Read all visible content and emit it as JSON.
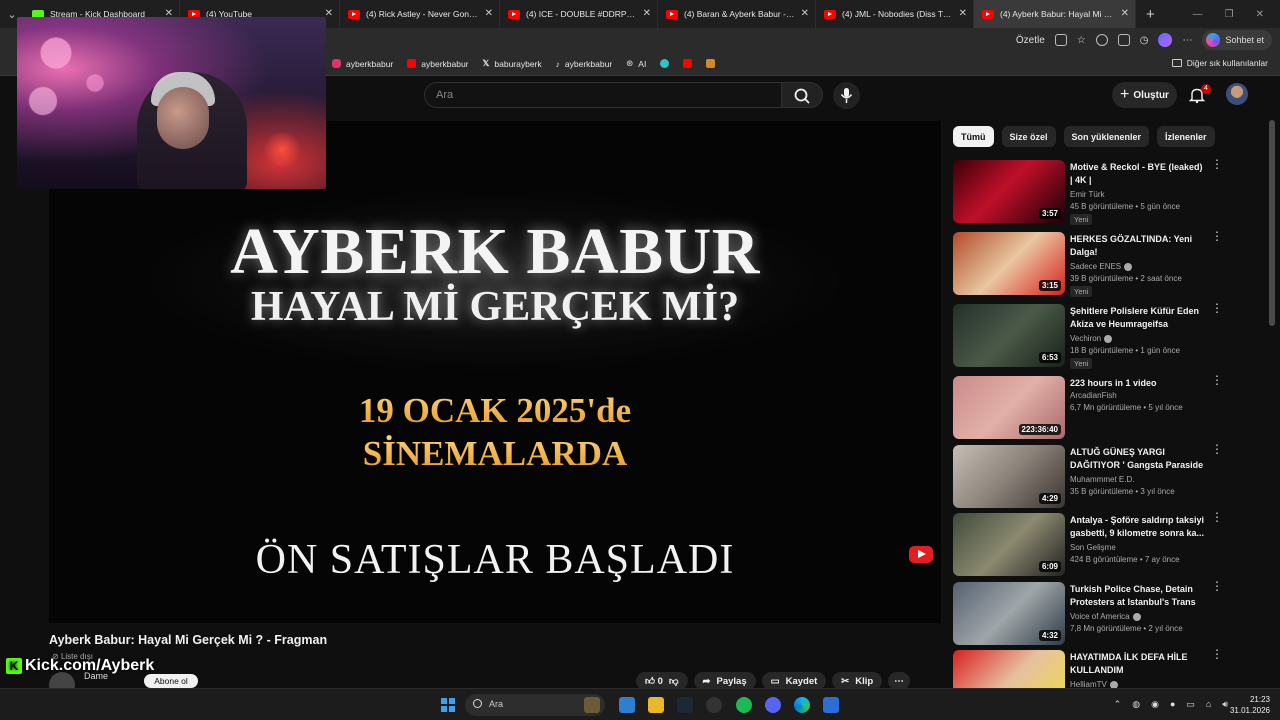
{
  "browser": {
    "tabs": [
      {
        "label": "Stream - Kick Dashboard",
        "icon": "kick-icon",
        "active": false
      },
      {
        "label": "(4) YouTube",
        "icon": "youtube-icon",
        "active": false
      },
      {
        "label": "(4) Rick Astley - Never Gonna Give You Up",
        "icon": "youtube-icon",
        "active": false
      },
      {
        "label": "(4) ICE - DOUBLE #DDRP - YouTube",
        "icon": "youtube-icon",
        "active": false
      },
      {
        "label": "(4) Baran & Ayberk Babur - Gang",
        "icon": "youtube-icon",
        "active": false
      },
      {
        "label": "(4) JML - Nobodies (Diss Track) #D",
        "icon": "youtube-icon",
        "active": false
      },
      {
        "label": "(4) Ayberk Babur: Hayal Mi Gerçek Mi",
        "icon": "youtube-icon",
        "active": true
      }
    ],
    "address_right": {
      "summarize_label": "Özetle",
      "copilot_label": "Sohbet et"
    },
    "bookmarks": [
      {
        "label": "ayberkbabur",
        "icon": "instagram-icon",
        "color": "#e1306c"
      },
      {
        "label": "ayberkbabur",
        "icon": "youtube-icon",
        "color": "#ff0000"
      },
      {
        "label": "baburayberk",
        "icon": "x-icon",
        "color": "#ffffff"
      },
      {
        "label": "ayberkbabur",
        "icon": "tiktok-icon",
        "color": "#ffffff"
      },
      {
        "label": "AI",
        "icon": "ai-icon",
        "color": "#cccccc"
      }
    ],
    "other_bookmarks_label": "Diğer sık kullanılanlar"
  },
  "youtube_header": {
    "search_placeholder": "Ara",
    "create_label": "Oluştur",
    "notification_count": "4"
  },
  "player": {
    "poster_title_line1": "AYBERK BABUR",
    "poster_title_line2": "HAYAL Mİ GERÇEK Mİ?",
    "poster_date_line1": "19 OCAK 2025'de",
    "poster_date_line2": "SİNEMALARDA",
    "poster_footer": "ÖN SATIŞLAR BAŞLADI"
  },
  "video_info": {
    "title": "Ayberk Babur: Hayal Mi Gerçek Mi ? - Fragman",
    "visibility": "Liste dışı",
    "channel": "Dame",
    "subscribe_label": "Abone ol",
    "like_count": "0",
    "share_label": "Paylaş",
    "save_label": "Kaydet",
    "clip_label": "Klip"
  },
  "overlay": {
    "kick_url": "Kick.com/Ayberk"
  },
  "sidebar": {
    "chips": [
      {
        "label": "Tümü",
        "selected": true
      },
      {
        "label": "Size özel",
        "selected": false
      },
      {
        "label": "Son yüklenenler",
        "selected": false
      },
      {
        "label": "İzlenenler",
        "selected": false
      }
    ],
    "recommendations": [
      {
        "title": "Motive & Reckol - BYE (leaked) | 4K |",
        "channel": "Emir Türk",
        "verified": false,
        "meta": "45 B görüntüleme • 5 gün önce",
        "badge": "Yeni",
        "duration": "3:57"
      },
      {
        "title": "HERKES GÖZALTINDA: Yeni Dalga!",
        "channel": "Sadece ENES",
        "verified": true,
        "meta": "39 B görüntüleme • 2 saat önce",
        "badge": "Yeni",
        "duration": "3:15"
      },
      {
        "title": "Şehitlere Polislere Küfür Eden Akiza ve Heumrageifsa ekibini...",
        "channel": "Vechiron",
        "verified": true,
        "meta": "18 B görüntüleme • 1 gün önce",
        "badge": "Yeni",
        "duration": "6:53"
      },
      {
        "title": "223 hours in 1 video",
        "channel": "ArcadianFish",
        "verified": false,
        "meta": "6,7 Mn görüntüleme • 5 yıl önce",
        "badge": "",
        "duration": "223:36:40"
      },
      {
        "title": "ALTUĞ GÜNEŞ YARGI DAĞITIYOR ' Gangsta Paraside '",
        "channel": "Muhammmet E.D.",
        "verified": false,
        "meta": "35 B görüntüleme • 3 yıl önce",
        "badge": "",
        "duration": "4:29"
      },
      {
        "title": "Antalya - Şoföre saldırıp taksiyi gasbetti, 9 kilometre sonra ka...",
        "channel": "Son Gelişme",
        "verified": false,
        "meta": "424 B görüntüleme • 7 ay önce",
        "badge": "",
        "duration": "6:09"
      },
      {
        "title": "Turkish Police Chase, Detain Protesters at Istanbul's Trans ...",
        "channel": "Voice of America",
        "verified": true,
        "meta": "7,8 Mn görüntüleme • 2 yıl önce",
        "badge": "",
        "duration": "4:32"
      },
      {
        "title": "HAYATIMDA İLK DEFA HİLE KULLANDIM",
        "channel": "HelliamTV",
        "verified": true,
        "meta": "",
        "badge": "",
        "duration": ""
      }
    ]
  },
  "taskbar": {
    "search_placeholder": "Ara",
    "time": "21:23",
    "date": "31.01.2026"
  }
}
